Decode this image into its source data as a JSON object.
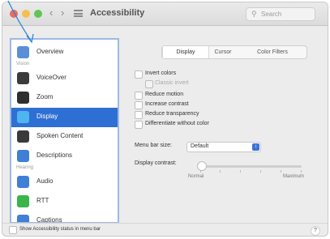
{
  "window": {
    "title": "Accessibility"
  },
  "toolbar": {
    "back": "‹",
    "forward": "›",
    "search_placeholder": "Search"
  },
  "sidebar": {
    "items": [
      {
        "label": "Overview",
        "icon": "overview-icon",
        "color": "#5a8fd8"
      },
      {
        "label": "VoiceOver",
        "icon": "voiceover-icon",
        "color": "#3b3b3b"
      },
      {
        "label": "Zoom",
        "icon": "zoom-icon",
        "color": "#2f2f2f"
      },
      {
        "label": "Display",
        "icon": "display-icon",
        "color": "#4fb5f0"
      },
      {
        "label": "Spoken Content",
        "icon": "spoken-content-icon",
        "color": "#3a3a3a"
      },
      {
        "label": "Descriptions",
        "icon": "descriptions-icon",
        "color": "#3f7fd6"
      },
      {
        "label": "Audio",
        "icon": "audio-icon",
        "color": "#3f7fd6"
      },
      {
        "label": "RTT",
        "icon": "rtt-icon",
        "color": "#39b54a"
      },
      {
        "label": "Captions",
        "icon": "captions-icon",
        "color": "#3f7fd6"
      }
    ],
    "sections": {
      "vision": "Vision",
      "hearing": "Hearing"
    },
    "selected": "Display"
  },
  "tabs": [
    "Display",
    "Cursor",
    "Color Filters"
  ],
  "active_tab": "Display",
  "options": [
    {
      "label": "Invert colors",
      "checked": false
    },
    {
      "label": "Classic invert",
      "checked": false,
      "sub": true
    },
    {
      "label": "Reduce motion",
      "checked": false
    },
    {
      "label": "Increase contrast",
      "checked": false
    },
    {
      "label": "Reduce transparency",
      "checked": false
    },
    {
      "label": "Differentiate without color",
      "checked": false
    }
  ],
  "menu_bar_size": {
    "label": "Menu bar size:",
    "value": "Default"
  },
  "display_contrast": {
    "label": "Display contrast:",
    "min_label": "Normal",
    "max_label": "Maximum",
    "value": 0
  },
  "footer": {
    "checkbox_label": "Show Accessibility status in menu bar",
    "help": "?"
  },
  "colors": {
    "accent": "#2e6fd3",
    "annotation": "#2b88d8",
    "close": "#ed6a5e",
    "minimize": "#f5bf4f",
    "zoom": "#61c554"
  }
}
